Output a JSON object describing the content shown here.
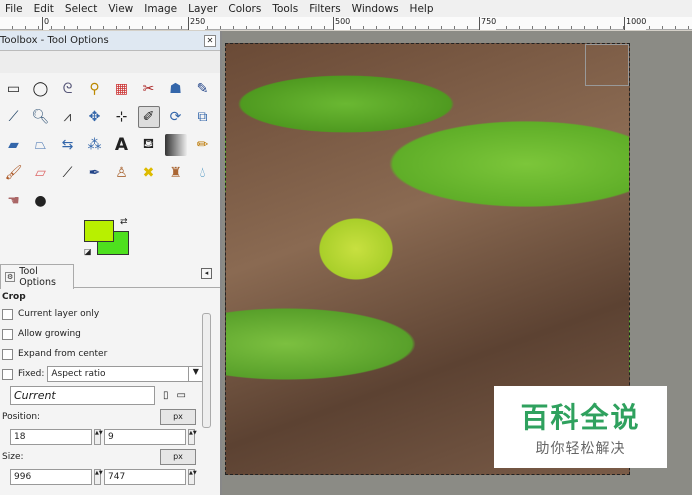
{
  "menu": [
    "File",
    "Edit",
    "Select",
    "View",
    "Image",
    "Layer",
    "Colors",
    "Tools",
    "Filters",
    "Windows",
    "Help"
  ],
  "ruler": {
    "labels": [
      "0",
      "250",
      "500",
      "750",
      "1000"
    ]
  },
  "toolbox": {
    "title": "Toolbox - Tool Options",
    "tools": [
      "rect-select",
      "ellipse-select",
      "free-select",
      "fuzzy-select",
      "select-by-color",
      "scissors",
      "foreground-select",
      "paths",
      "color-picker",
      "zoom",
      "measure",
      "move",
      "align",
      "crop",
      "rotate",
      "scale",
      "shear",
      "perspective",
      "flip",
      "cage",
      "text",
      "bucket-fill",
      "blend",
      "pencil",
      "paintbrush",
      "eraser",
      "airbrush",
      "ink",
      "clone",
      "heal",
      "perspective-clone",
      "blur",
      "smudge",
      "dodge-burn"
    ],
    "fg_color": "#b8f000",
    "bg_color": "#4ee01e"
  },
  "tool_options": {
    "tab_label": "Tool Options",
    "section": "Crop",
    "current_layer_only": "Current layer only",
    "allow_growing": "Allow growing",
    "expand_from_center": "Expand from center",
    "fixed_label": "Fixed:",
    "fixed_value": "Aspect ratio",
    "current_value": "Current",
    "position_label": "Position:",
    "position_unit": "px",
    "position_x": "18",
    "position_y": "9",
    "size_label": "Size:",
    "size_unit": "px",
    "size_w": "996",
    "size_h": "747"
  },
  "watermark": {
    "title": "百科全说",
    "subtitle": "助你轻松解决"
  }
}
